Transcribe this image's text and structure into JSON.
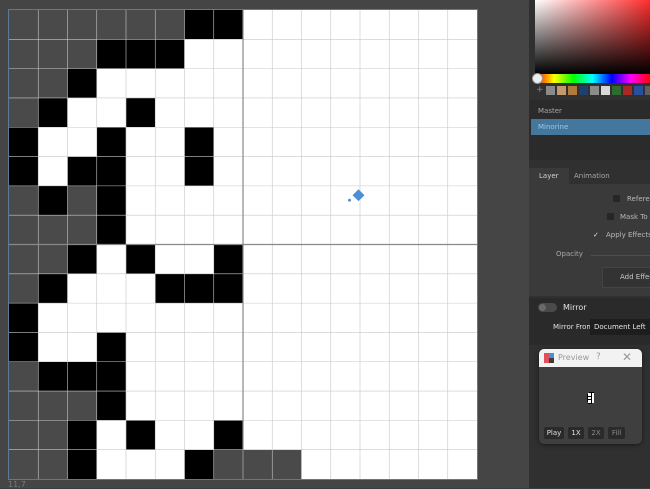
{
  "canvas": {
    "status": "11,7",
    "guide_color": "#888888",
    "grid_color": "#c7c7c7",
    "pixel_colors": {
      "black": "#000000",
      "gray": "#4a4a4a",
      "white": "#ffffff"
    },
    "pixel_rows": [
      "GGGGGGBBWWWWWWWW",
      "GGGBBBWWWWWWWWWW",
      "GGBWWWWWWWWWWWWW",
      "GBWWBWWWWWWWWWWW",
      "BWWBWWBWWWWWWWWW",
      "BWBBWWBWWWWWWWWW",
      "GBGBWWWWWWWWWWWW",
      "GGGBWWWWWWWWWWWW",
      "GGBWBWWBWWWWWWWW",
      "GBWWWBBBWWWWWWWW",
      "BWWWWWWWWWWWWWWW",
      "BWWBWWWWWWWWWWWW",
      "GBBBWWWWWWWWWWWW",
      "GGGBWWWWWWWWWWWW",
      "GGBWBWWBWWWWWWWW",
      "GGBWWWBGGGWWWWWW"
    ],
    "cursor_color": "#4a90d9"
  },
  "color_picker": {
    "swatch_add": "+",
    "swatches": [
      "#8a8a8a",
      "#c49a6c",
      "#b07a3a",
      "#1f3f6e",
      "#8c8c8c",
      "#d8d8d8",
      "#2f6b2f",
      "#a82828",
      "#2a4fa0",
      "#606060"
    ]
  },
  "palettes": {
    "items": [
      {
        "label": "Master"
      },
      {
        "label": "Minorine"
      }
    ],
    "accent": "#43779d"
  },
  "tabs": {
    "layer": "Layer",
    "animation": "Animation"
  },
  "layer_properties": {
    "reference_label": "Reference",
    "mask_label": "Mask To P",
    "apply_effects_label": "Apply Effects T",
    "apply_effects_checked": true,
    "check_mark": "✓",
    "opacity_label": "Opacity",
    "add_effect_label": "Add Effect"
  },
  "mirror": {
    "label": "Mirror",
    "from_label": "Mirror From",
    "from_value": "Document Left",
    "enabled": false
  },
  "preview": {
    "title": "Preview",
    "help_icon": "?",
    "close_icon": "✕",
    "buttons": {
      "play": "Play",
      "speed_1x": "1X",
      "speed_2x": "2X",
      "fill": "Fill"
    },
    "icon_colors": [
      "#e0505a",
      "#4a90d9",
      "#3d3d3d"
    ]
  }
}
